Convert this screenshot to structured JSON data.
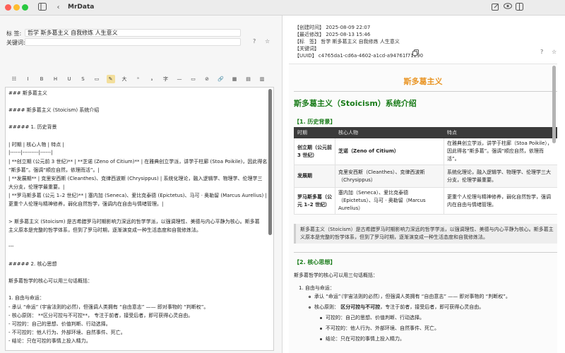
{
  "window": {
    "title": "MrData"
  },
  "left": {
    "tags": {
      "label": "标 签:",
      "value": "哲学 斯多葛主义 自我修炼 人生意义"
    },
    "keywords": {
      "label": "关键词:",
      "value": ""
    },
    "controls": {
      "help": "?",
      "star": "☆"
    },
    "toolbar": [
      "☷",
      "I",
      "B",
      "H",
      "U",
      "S",
      "▭",
      "✎",
      "大",
      "ᵃ",
      "ₐ",
      "字",
      "—",
      "▭",
      "⊘",
      "🔗",
      "▦",
      "▤",
      "▥"
    ],
    "editor_lines": [
      "### 斯多葛主义",
      "",
      "#### 斯多葛主义 (Stoicism) 系统介绍",
      "",
      "##### 1. 历史背景",
      "",
      "| 时期 | 核心人物 | 特点 |",
      "|------|---------|------|",
      "| **创立期 (公元前 3 世纪)** | **芝诺 (Zeno of Citium)** | 在雅典创立学派，讲学于柱廊 (Stoa Poikile)，因此得名",
      "“斯多葛”。强调“顺应自然，依理而活”。|",
      "| **发展期** | 克里安西斯 (Cleanthes)、克律西波斯 (Chrysippus) | 系统化理论，融入逻辑学、物理学、伦理学三",
      "大分支，伦理学最重要。|",
      "| **罗马斯多葛 (公元 1–2 世纪)** | 塞内加 (Seneca)、爱比克泰德 (Epictetus)、马可 · 奥勒留 (Marcus Aurelius) |",
      "更重个人伦理与精神修养，弱化自然哲学，强调内在自由与情绪管理。|",
      "",
      "> 斯多葛主义 (Stoicism) 是古希腊罗马时期影响力深远的哲学学派，以强调理性、美德与内心平静为核心。斯多葛",
      "主义原本是完整的哲学体系，但到了罗马时期，逐渐演变成一种生活态度和自我修炼法。",
      "",
      "---",
      "",
      "##### 2. 核心思想",
      "",
      "斯多葛哲学的核心可以用三句话概括：",
      "",
      "1. 自由与命运：",
      "      - 承认 “命运” (宇宙法则的必然)，但强调人类拥有 “自由意志” —— 即对事物的 “判断权”。",
      "      - 核心原则： **区分可控与不可控**， 专注于前者，接受后者，即可获得心灵自由。",
      "            - 可控的：自己的思想、价值判断、行动选择。",
      "            - 不可控的：他人行为、外部环境、自然事件、死亡。",
      "            - 结论：只在可控的事情上投入精力。"
    ]
  },
  "right": {
    "meta": {
      "created": "【创建时间】  2025-08-09 22:07",
      "modified": "【最近修改】  2025-08-13 15:46",
      "tags": "【标　签】  哲学 斯多葛主义 自我修炼 人生意义",
      "keywords": "【关键词】",
      "uuid": "【UUID】  c4765da1-cd6a-4602-a1cd-a94761f71290"
    },
    "controls": {
      "help": "?",
      "star": "☆"
    },
    "preview": {
      "title": "斯多葛主义",
      "h2": "斯多葛主义（Stoicism）系统介绍",
      "sec1": "【1. 历史背景】",
      "table": {
        "headers": [
          "时期",
          "核心人物",
          "特点"
        ],
        "rows": [
          [
            "创立期（公元前 3 世纪）",
            "芝诺（Zeno of Citium）",
            "在雅典创立学派，讲学于柱廊（Stoa Poikile），因此得名“斯多葛”。强调“顺应自然，依理而活”。"
          ],
          [
            "发展期",
            "克里安西斯（Cleanthes）、克律西波斯（Chrysippus）",
            "系统化理论，融入逻辑学、物理学、伦理学三大分支，伦理学最重要。"
          ],
          [
            "罗马斯多葛（公元 1–2 世纪）",
            "塞内加（Seneca）、爱比克泰德（Epictetus）、马可 · 奥勒留（Marcus Aurelius）",
            "更重个人伦理与精神修养，弱化自然哲学，强调内在自由与情绪管理。"
          ]
        ]
      },
      "quote": "斯多葛主义（Stoicism）是古希腊罗马时期影响力深远的哲学学派，以强调理性、美德与内心平静为核心。斯多葛主义原本是完整的哲学体系，但到了罗马时期，逐渐演变成一种生活态度和自我修炼法。",
      "sec2": "【2. 核心思想】",
      "intro": "斯多葛哲学的核心可以用三句话概括：",
      "item1": "1. 自由与命运：",
      "sub1": "承认 “命运”（宇宙法则的必然），但强调人类拥有 “自由意志” —— 即对事物的 “判断权”。",
      "sub2_label": "核心原则：",
      "sub2_bold": "区分可控与不可控",
      "sub2_rest": "，专注于前者，接受后者，即可获得心灵自由。",
      "subsub": [
        "可控的：自己的思想、价值判断、行动选择。",
        "不可控的：他人行为、外部环境、自然事件、死亡。",
        "结论：只在可控的事情上投入精力。"
      ]
    }
  },
  "colors": {
    "accent_orange": "#e99423",
    "heading_green": "#1a7c1a",
    "table_header": "#3a3a3a"
  },
  "icons": [
    "sidebar-toggle-icon",
    "back-chevron-icon",
    "edit-icon",
    "eye-icon",
    "split-view-icon",
    "copy-icon"
  ]
}
